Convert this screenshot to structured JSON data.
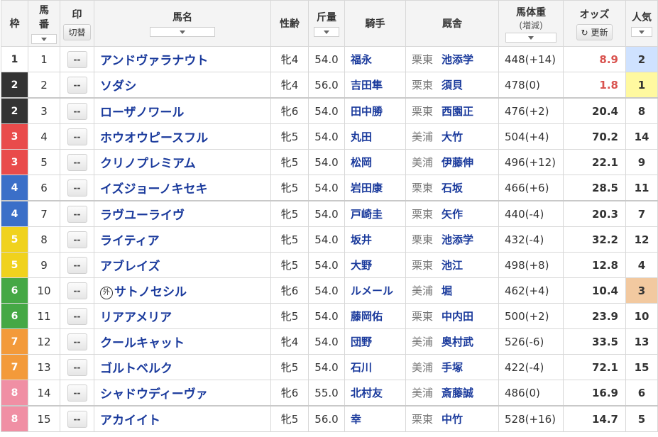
{
  "headers": {
    "waku": "枠",
    "umaban": "馬\n番",
    "umaban_1": "馬",
    "umaban_2": "番",
    "mark": "印",
    "mark_toggle": "切替",
    "name": "馬名",
    "sexage": "性齢",
    "weight": "斤量",
    "jockey": "騎手",
    "stable": "厩舎",
    "bodyweight": "馬体重",
    "bodyweight_sub": "(増減)",
    "odds": "オッズ",
    "odds_refresh": "更新",
    "pop": "人気"
  },
  "mark_placeholder": "--",
  "colors": {
    "waku1": "#ffffff",
    "waku2": "#333333",
    "waku3": "#e94b4b",
    "waku4": "#3b6fc8",
    "waku5": "#f0d21d",
    "waku6": "#45a845",
    "waku7": "#f39a3a",
    "waku8": "#f08fa4",
    "pop1": "#fff9a0",
    "pop2": "#cfe2ff",
    "pop3": "#f2c9a0"
  },
  "rows": [
    {
      "waku": "1",
      "umaban": "1",
      "name": "アンドヴァラナウト",
      "gai": "",
      "sexage": "牝4",
      "weight": "54.0",
      "jockey": "福永",
      "area": "栗東",
      "trainer": "池添学",
      "bw": "448(+14)",
      "odds": "8.9",
      "hot": true,
      "pop": "2"
    },
    {
      "waku": "2",
      "umaban": "2",
      "name": "ソダシ",
      "gai": "",
      "sexage": "牝4",
      "weight": "56.0",
      "jockey": "吉田隼",
      "area": "栗東",
      "trainer": "須貝",
      "bw": "478(0)",
      "odds": "1.8",
      "hot": true,
      "pop": "1"
    },
    {
      "waku": "2",
      "umaban": "3",
      "name": "ローザノワール",
      "gai": "",
      "sexage": "牝6",
      "weight": "54.0",
      "jockey": "田中勝",
      "area": "栗東",
      "trainer": "西園正",
      "bw": "476(+2)",
      "odds": "20.4",
      "hot": false,
      "pop": "8"
    },
    {
      "waku": "3",
      "umaban": "4",
      "name": "ホウオウピースフル",
      "gai": "",
      "sexage": "牝5",
      "weight": "54.0",
      "jockey": "丸田",
      "area": "美浦",
      "trainer": "大竹",
      "bw": "504(+4)",
      "odds": "70.2",
      "hot": false,
      "pop": "14"
    },
    {
      "waku": "3",
      "umaban": "5",
      "name": "クリノプレミアム",
      "gai": "",
      "sexage": "牝5",
      "weight": "54.0",
      "jockey": "松岡",
      "area": "美浦",
      "trainer": "伊藤伸",
      "bw": "496(+12)",
      "odds": "22.1",
      "hot": false,
      "pop": "9"
    },
    {
      "waku": "4",
      "umaban": "6",
      "name": "イズジョーノキセキ",
      "gai": "",
      "sexage": "牝5",
      "weight": "54.0",
      "jockey": "岩田康",
      "area": "栗東",
      "trainer": "石坂",
      "bw": "466(+6)",
      "odds": "28.5",
      "hot": false,
      "pop": "11"
    },
    {
      "waku": "4",
      "umaban": "7",
      "name": "ラヴユーライヴ",
      "gai": "",
      "sexage": "牝5",
      "weight": "54.0",
      "jockey": "戸崎圭",
      "area": "栗東",
      "trainer": "矢作",
      "bw": "440(-4)",
      "odds": "20.3",
      "hot": false,
      "pop": "7"
    },
    {
      "waku": "5",
      "umaban": "8",
      "name": "ライティア",
      "gai": "",
      "sexage": "牝5",
      "weight": "54.0",
      "jockey": "坂井",
      "area": "栗東",
      "trainer": "池添学",
      "bw": "432(-4)",
      "odds": "32.2",
      "hot": false,
      "pop": "12"
    },
    {
      "waku": "5",
      "umaban": "9",
      "name": "アブレイズ",
      "gai": "",
      "sexage": "牝5",
      "weight": "54.0",
      "jockey": "大野",
      "area": "栗東",
      "trainer": "池江",
      "bw": "498(+8)",
      "odds": "12.8",
      "hot": false,
      "pop": "4"
    },
    {
      "waku": "6",
      "umaban": "10",
      "name": "サトノセシル",
      "gai": "外",
      "sexage": "牝6",
      "weight": "54.0",
      "jockey": "ルメール",
      "area": "美浦",
      "trainer": "堀",
      "bw": "462(+4)",
      "odds": "10.4",
      "hot": false,
      "pop": "3"
    },
    {
      "waku": "6",
      "umaban": "11",
      "name": "リアアメリア",
      "gai": "",
      "sexage": "牝5",
      "weight": "54.0",
      "jockey": "藤岡佑",
      "area": "栗東",
      "trainer": "中内田",
      "bw": "500(+2)",
      "odds": "23.9",
      "hot": false,
      "pop": "10"
    },
    {
      "waku": "7",
      "umaban": "12",
      "name": "クールキャット",
      "gai": "",
      "sexage": "牝4",
      "weight": "54.0",
      "jockey": "団野",
      "area": "美浦",
      "trainer": "奥村武",
      "bw": "526(-6)",
      "odds": "33.5",
      "hot": false,
      "pop": "13"
    },
    {
      "waku": "7",
      "umaban": "13",
      "name": "ゴルトベルク",
      "gai": "",
      "sexage": "牝5",
      "weight": "54.0",
      "jockey": "石川",
      "area": "美浦",
      "trainer": "手塚",
      "bw": "422(-4)",
      "odds": "72.1",
      "hot": false,
      "pop": "15"
    },
    {
      "waku": "8",
      "umaban": "14",
      "name": "シャドウディーヴァ",
      "gai": "",
      "sexage": "牝6",
      "weight": "55.0",
      "jockey": "北村友",
      "area": "美浦",
      "trainer": "斎藤誠",
      "bw": "486(0)",
      "odds": "16.9",
      "hot": false,
      "pop": "6"
    },
    {
      "waku": "8",
      "umaban": "15",
      "name": "アカイイト",
      "gai": "",
      "sexage": "牝5",
      "weight": "56.0",
      "jockey": "幸",
      "area": "栗東",
      "trainer": "中竹",
      "bw": "528(+16)",
      "odds": "14.7",
      "hot": false,
      "pop": "5"
    }
  ]
}
